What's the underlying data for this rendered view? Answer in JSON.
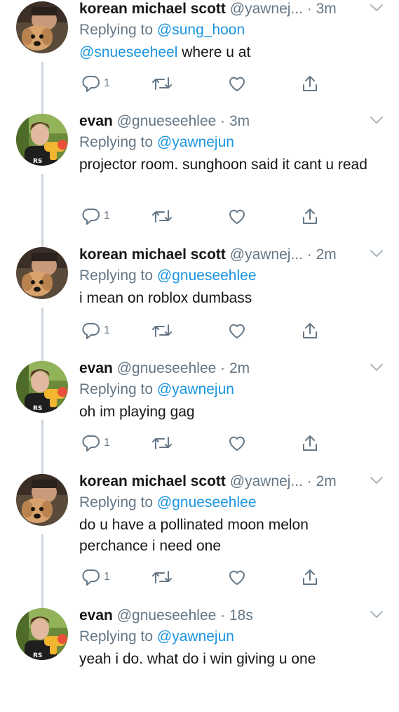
{
  "colors": {
    "name": "#14171a",
    "muted": "#657786",
    "link": "#1b95e0",
    "line": "#cdd5dc"
  },
  "tweets": [
    {
      "name": "korean michael scott",
      "handle": "@yawnej... · 3m",
      "replying_label": "Replying to",
      "replying_to": "@sung_hoon",
      "mention": "@snueseeheel",
      "text": " where u at",
      "reply_count": "1",
      "avatar": "dog-selfie"
    },
    {
      "name": "evan",
      "handle": "@gnueseehlee · 3m",
      "replying_label": "Replying to",
      "replying_to": "@yawnejun",
      "mention": "",
      "text": "projector room. sunghoon said it cant u read",
      "reply_count": "1",
      "avatar": "boy-toy"
    },
    {
      "name": "korean michael scott",
      "handle": "@yawnej... · 2m",
      "replying_label": "Replying to",
      "replying_to": "@gnueseehlee",
      "mention": "",
      "text": "i mean on roblox dumbass",
      "reply_count": "1",
      "avatar": "dog-selfie"
    },
    {
      "name": "evan",
      "handle": "@gnueseehlee · 2m",
      "replying_label": "Replying to",
      "replying_to": "@yawnejun",
      "mention": "",
      "text": "oh im playing gag",
      "reply_count": "1",
      "avatar": "boy-toy"
    },
    {
      "name": "korean michael scott",
      "handle": "@yawnej... · 2m",
      "replying_label": "Replying to",
      "replying_to": "@gnueseehlee",
      "mention": "",
      "text": "do u have a pollinated moon melon perchance i need one",
      "reply_count": "1",
      "avatar": "dog-selfie"
    },
    {
      "name": "evan",
      "handle": "@gnueseehlee · 18s",
      "replying_label": "Replying to",
      "replying_to": "@yawnejun",
      "mention": "",
      "text": "yeah i do. what do i win giving u one",
      "reply_count": "",
      "avatar": "boy-toy"
    }
  ]
}
